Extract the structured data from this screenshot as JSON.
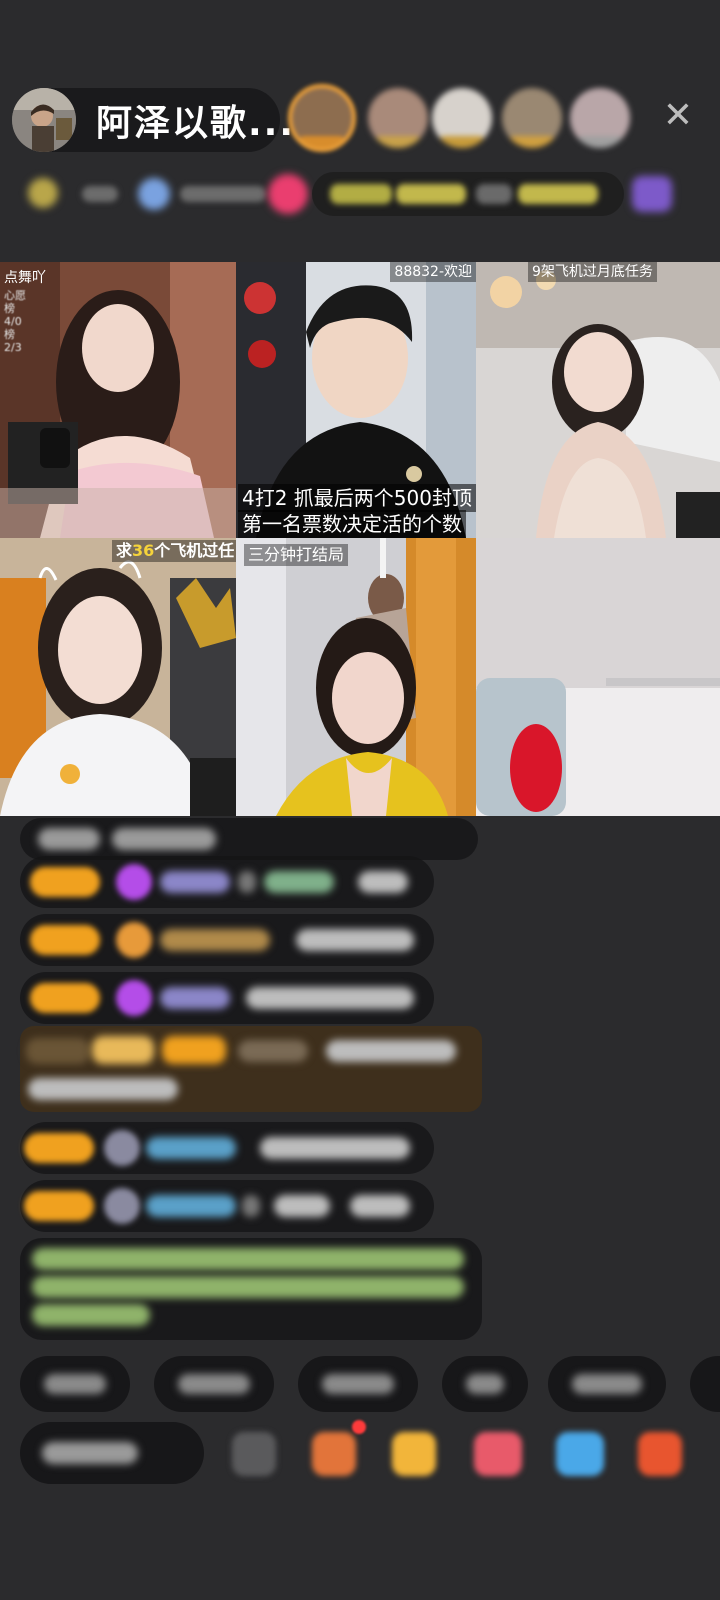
{
  "header": {
    "host_name": "阿泽以歌...",
    "close_icon_glyph": "✕"
  },
  "video_tiles": [
    {
      "id": "tile-1",
      "label": "点舞吖",
      "side_text": "心愿 榜4/0 榜2/3"
    },
    {
      "id": "tile-2",
      "label": "88832-欢迎",
      "overlay_line1": "4打2  抓最后两个500封顶",
      "overlay_line2": "第一名票数决定活的个数"
    },
    {
      "id": "tile-3",
      "label": "9架飞机过月底任务"
    },
    {
      "id": "tile-4",
      "label_prefix": "求",
      "label_number": "36",
      "label_suffix": "个飞机过任"
    },
    {
      "id": "tile-5",
      "label": "三分钟打结局"
    },
    {
      "id": "tile-6"
    }
  ],
  "colors": {
    "background": "#2b2b2d",
    "pill": "#1a1a1c",
    "level_badge": "#f0a11f",
    "host_ring": "#f2a43a",
    "accent_yellow": "#f5d33b"
  },
  "icons": [
    "host-avatar",
    "close-icon",
    "gem-icon",
    "gift-icon",
    "share-icon",
    "more-icon"
  ]
}
